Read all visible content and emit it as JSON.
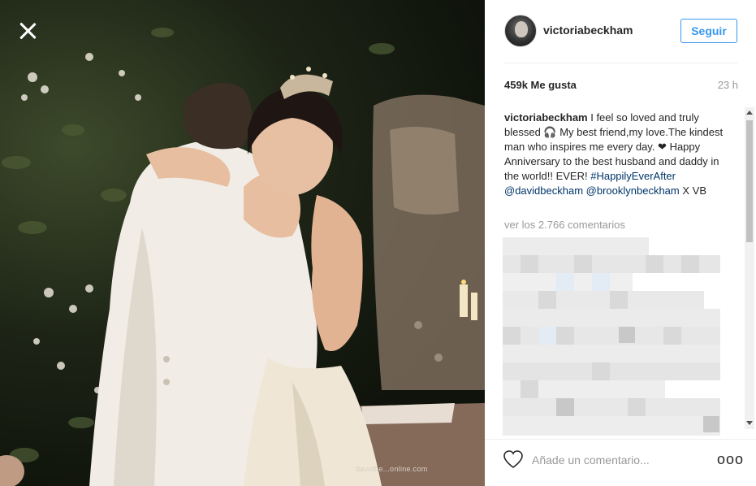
{
  "post": {
    "username": "victoriabeckham",
    "follow_label": "Seguir",
    "likes": "459k Me gusta",
    "time": "23 h",
    "caption": {
      "user": "victoriabeckham",
      "text": " I feel so loved and truly blessed 🎧 My best friend,my love.The kindest man who inspires me every day. ❤ Happy Anniversary to the best husband and daddy in the world!! EVER! ",
      "hashtag": "#HappilyEverAfter",
      "mention1": "@davidbeckham",
      "mention2": "@brooklynbeckham",
      "tail": " X VB"
    },
    "view_comments": "ver los 2.766 comentarios",
    "comment_placeholder": "Añade un comentario...",
    "more_label": "ooo"
  },
  "photo": {
    "watermark": "davidbe...online.com"
  },
  "icons": {
    "close": "close-icon",
    "heart": "heart-icon",
    "more": "more-options-icon"
  },
  "colors": {
    "accent": "#3897f0",
    "link": "#003569",
    "muted": "#999999"
  }
}
